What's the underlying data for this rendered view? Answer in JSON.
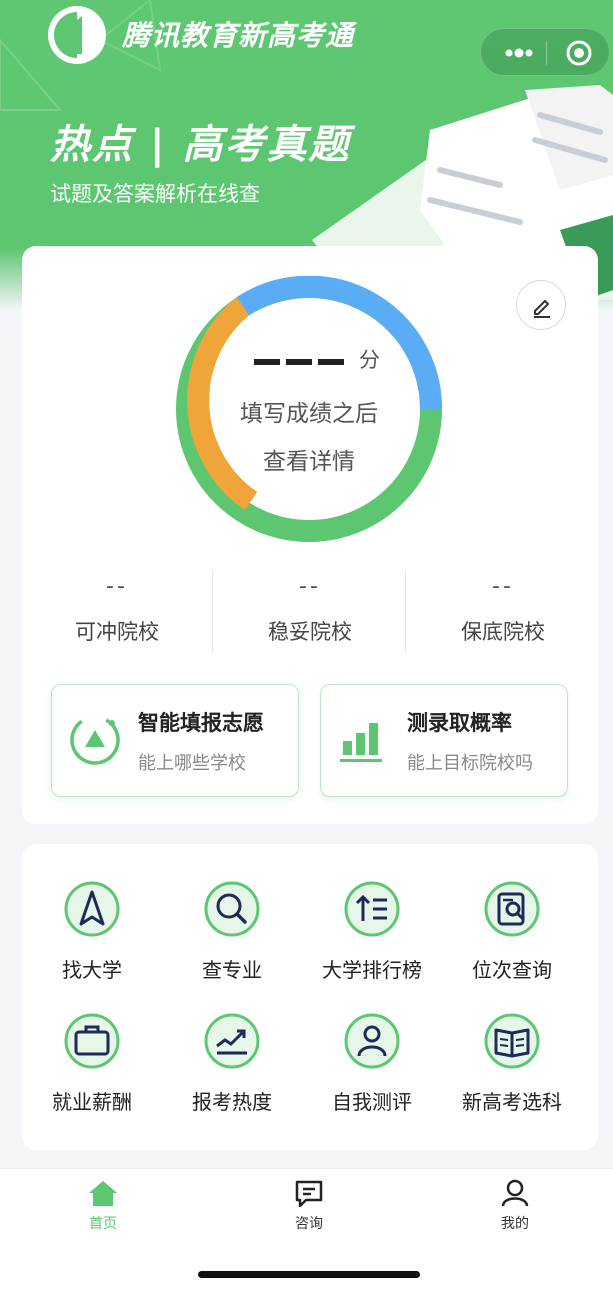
{
  "header": {
    "app_title": "腾讯教育新高考通",
    "banner_title": "热点 | 高考真题",
    "banner_subtitle": "试题及答案解析在线查"
  },
  "score_panel": {
    "score_placeholder": "———",
    "score_unit": "分",
    "prompt_line1": "填写成绩之后",
    "prompt_line2": "查看详情",
    "ring_colors": {
      "orange": "#f0a53a",
      "blue": "#5aacf5",
      "green": "#5cc670"
    }
  },
  "stats": [
    {
      "value": "--",
      "label": "可冲院校"
    },
    {
      "value": "--",
      "label": "稳妥院校"
    },
    {
      "value": "--",
      "label": "保底院校"
    }
  ],
  "features": [
    {
      "title": "智能填报志愿",
      "subtitle": "能上哪些学校",
      "icon": "triangle-gauge-icon"
    },
    {
      "title": "测录取概率",
      "subtitle": "能上目标院校吗",
      "icon": "bar-chart-icon"
    }
  ],
  "grid": [
    {
      "label": "找大学",
      "icon": "navigation-arrow-icon"
    },
    {
      "label": "查专业",
      "icon": "search-icon"
    },
    {
      "label": "大学排行榜",
      "icon": "ranking-list-icon"
    },
    {
      "label": "位次查询",
      "icon": "document-search-icon"
    },
    {
      "label": "就业薪酬",
      "icon": "briefcase-icon"
    },
    {
      "label": "报考热度",
      "icon": "trend-chart-icon"
    },
    {
      "label": "自我测评",
      "icon": "person-icon"
    },
    {
      "label": "新高考选科",
      "icon": "open-book-icon"
    }
  ],
  "tabbar": [
    {
      "label": "首页",
      "active": true,
      "icon": "home-icon"
    },
    {
      "label": "咨询",
      "active": false,
      "icon": "chat-icon"
    },
    {
      "label": "我的",
      "active": false,
      "icon": "user-icon"
    }
  ],
  "colors": {
    "accent": "#5cc670",
    "navy": "#1f2a5a"
  }
}
